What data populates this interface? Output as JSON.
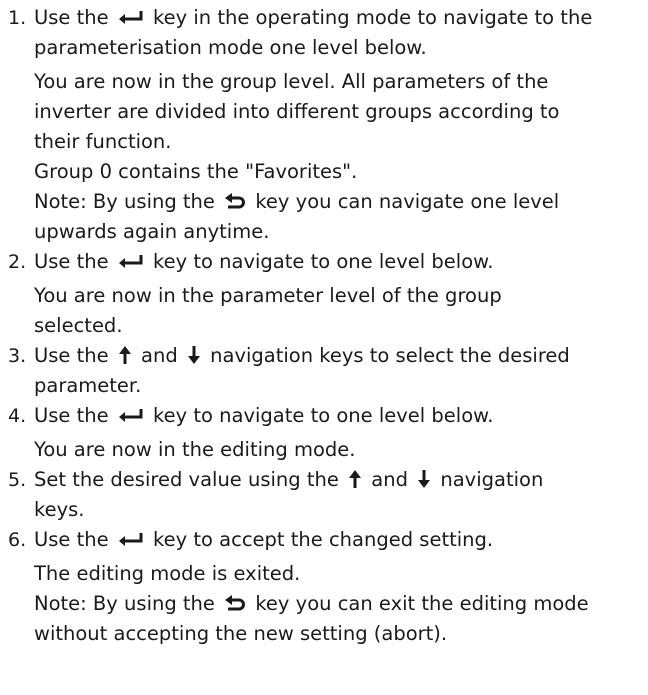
{
  "steps": [
    {
      "number": "1.",
      "text": [
        [
          "Use the",
          "enter-icon",
          "key in the operating mode to navigate to the"
        ],
        [
          "parameterisation mode one level below."
        ]
      ],
      "details": [
        [
          "You are now in the group level. All parameters of the",
          "inverter are divided into different groups according to",
          "their function."
        ],
        [
          "Group 0 contains the \"Favorites\"."
        ],
        [
          "Note: By using the",
          "back-icon",
          "key you can navigate one level",
          "upwards again anytime."
        ]
      ]
    },
    {
      "number": "2.",
      "text": [
        [
          "Use the",
          "enter-icon",
          "key to navigate to one level below."
        ]
      ],
      "details": [
        [
          "You are now in the parameter level of the group",
          "selected."
        ]
      ]
    },
    {
      "number": "3.",
      "text": [
        [
          "Use the",
          "up-arrow-icon",
          "and",
          "down-arrow-icon",
          "navigation keys to select the desired"
        ],
        [
          "parameter."
        ]
      ],
      "details": []
    },
    {
      "number": "4.",
      "text": [
        [
          "Use the",
          "enter-icon",
          "key to navigate to one level below."
        ]
      ],
      "details": [
        [
          "You are now in the editing mode."
        ]
      ]
    },
    {
      "number": "5.",
      "text": [
        [
          "Set the desired value using the",
          "up-arrow-icon",
          "and",
          "down-arrow-icon",
          "navigation"
        ],
        [
          "keys."
        ]
      ],
      "details": []
    },
    {
      "number": "6.",
      "text": [
        [
          "Use the",
          "enter-icon",
          "key to accept the changed setting."
        ]
      ],
      "details": [
        [
          "The editing mode is exited."
        ],
        [
          "Note: By using the",
          "back-icon",
          "key you can exit the editing mode",
          "without accepting the new setting (abort)."
        ]
      ]
    }
  ],
  "icons": {
    "enter": "enter-icon",
    "back": "back-icon",
    "up": "up-arrow-icon",
    "down": "down-arrow-icon"
  }
}
